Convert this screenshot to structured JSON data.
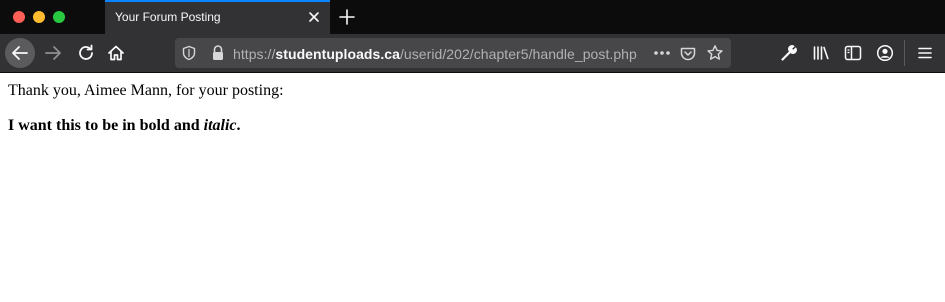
{
  "tab": {
    "title": "Your Forum Posting"
  },
  "urlbar": {
    "scheme": "https://",
    "host": "studentuploads.ca",
    "path": "/userid/202/chapter5/handle_post.php"
  },
  "icons": {
    "back": "back-arrow-icon",
    "forward": "forward-arrow-icon",
    "reload": "reload-icon",
    "home": "home-icon",
    "tracking": "tracking-shield-icon",
    "lock": "lock-icon",
    "page_actions": "more-horizontal-icon",
    "pocket": "pocket-icon",
    "bookmark": "star-icon",
    "tools": "wrench-icon",
    "library": "library-icon",
    "sidebar": "sidebar-icon",
    "account": "account-icon",
    "menu": "hamburger-menu-icon"
  },
  "colors": {
    "tab_accent": "#0a84ff",
    "toolbar": "#323234",
    "tabstrip": "#0c0c0d"
  },
  "content": {
    "line1": "Thank you, Aimee Mann, for your posting:",
    "line2_part1": "I want this to be in bold and ",
    "line2_italic": "italic",
    "line2_end": "."
  }
}
